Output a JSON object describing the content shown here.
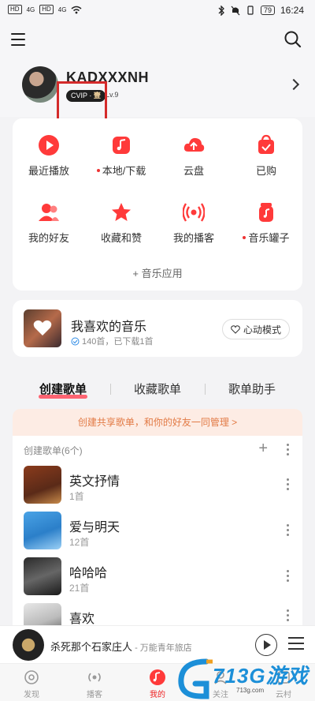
{
  "status": {
    "sim1": "HD",
    "sim2": "HD",
    "net1": "4G",
    "net2": "4G",
    "battery": "79",
    "time": "16:24"
  },
  "profile": {
    "username": "KADXXXNH",
    "vip": "CVIP",
    "vip_level": "壹",
    "level": "Lv.9"
  },
  "grid": [
    {
      "label": "最近播放",
      "icon": "play-circle-icon",
      "dot": false
    },
    {
      "label": "本地/下载",
      "icon": "music-folder-icon",
      "dot": true
    },
    {
      "label": "云盘",
      "icon": "cloud-upload-icon",
      "dot": false
    },
    {
      "label": "已购",
      "icon": "bag-check-icon",
      "dot": false
    },
    {
      "label": "我的好友",
      "icon": "friends-icon",
      "dot": false
    },
    {
      "label": "收藏和赞",
      "icon": "star-icon",
      "dot": false
    },
    {
      "label": "我的播客",
      "icon": "broadcast-icon",
      "dot": false
    },
    {
      "label": "音乐罐子",
      "icon": "music-jar-icon",
      "dot": true
    }
  ],
  "music_apps": "+ 音乐应用",
  "favorite": {
    "title": "我喜欢的音乐",
    "subtitle": "140首，已下载1首",
    "mode_button": "心动模式"
  },
  "tabs": [
    "创建歌单",
    "收藏歌单",
    "歌单助手"
  ],
  "share_banner": "创建共享歌单，和你的好友一同管理 >",
  "playlists": {
    "header": "创建歌单(6个)",
    "items": [
      {
        "name": "英文抒情",
        "count": "1首"
      },
      {
        "name": "爱与明天",
        "count": "12首"
      },
      {
        "name": "哈哈哈",
        "count": "21首"
      },
      {
        "name": "喜欢",
        "count": ""
      }
    ]
  },
  "player": {
    "song": "杀死那个石家庄人",
    "artist": " - 万能青年旅店"
  },
  "nav": [
    {
      "label": "发现",
      "icon": "discover-icon"
    },
    {
      "label": "播客",
      "icon": "podcast-icon"
    },
    {
      "label": "我的",
      "icon": "my-music-icon"
    },
    {
      "label": "关注",
      "icon": "follow-icon"
    },
    {
      "label": "云村",
      "icon": "cloud-village-icon"
    }
  ],
  "watermark": {
    "text": "713G游戏",
    "url": "713g.com"
  },
  "colors": {
    "accent": "#ff3a3a",
    "banner_text": "#e27a45",
    "banner_bg": "#fdece4"
  }
}
